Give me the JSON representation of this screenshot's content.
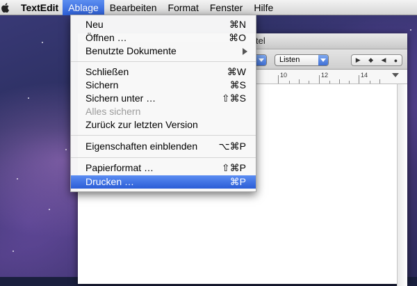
{
  "menubar": {
    "app_name": "TextEdit",
    "menus": [
      "Ablage",
      "Bearbeiten",
      "Format",
      "Fenster",
      "Hilfe"
    ],
    "open_menu": "Ablage"
  },
  "window": {
    "title_fragment": "tel",
    "toolbar": {
      "list_popup": "Listen"
    },
    "ruler": {
      "numbers": [
        "10",
        "12",
        "14"
      ]
    }
  },
  "dropdown": {
    "items": [
      {
        "label": "Neu",
        "shortcut": "⌘N"
      },
      {
        "label": "Öffnen …",
        "shortcut": "⌘O"
      },
      {
        "label": "Benutzte Dokumente",
        "shortcut": ""
      },
      {
        "label": "Schließen",
        "shortcut": "⌘W"
      },
      {
        "label": "Sichern",
        "shortcut": "⌘S"
      },
      {
        "label": "Sichern unter …",
        "shortcut": "⇧⌘S"
      },
      {
        "label": "Alles sichern",
        "shortcut": ""
      },
      {
        "label": "Zurück zur letzten Version",
        "shortcut": ""
      },
      {
        "label": "Eigenschaften einblenden",
        "shortcut": "⌥⌘P"
      },
      {
        "label": "Papierformat …",
        "shortcut": "⇧⌘P"
      },
      {
        "label": "Drucken …",
        "shortcut": "⌘P"
      }
    ],
    "disabled_item": "Alles sichern",
    "selected_item": "Drucken …"
  },
  "colors": {
    "menu_highlight": "#3b6fe0",
    "desktop": "#2f3366"
  }
}
